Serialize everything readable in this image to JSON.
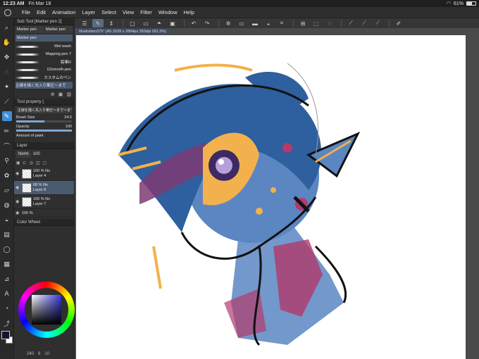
{
  "status": {
    "time": "12:23 AM",
    "date": "Fri Mar 18",
    "battery": "61%",
    "battery_level": 61
  },
  "menu": [
    "File",
    "Edit",
    "Animation",
    "Layer",
    "Select",
    "View",
    "Filter",
    "Window",
    "Help"
  ],
  "subtool": {
    "header": "Sub Tool [Marker pen 2]",
    "tabs": [
      "Marker pen",
      "Marker pen",
      "Marker pen"
    ],
    "brushes": [
      "Wet wash",
      "Mapping pen 7",
      "鉛筆R",
      "GSmooth-pen",
      "カスタムのペン",
      "主線を描く先入り筆圧〜まで"
    ]
  },
  "toolprop": {
    "header": "Tool property [",
    "banner": "主線を描く先入り筆圧〜まで〜まで",
    "brush_size_label": "Brush Size",
    "brush_size_value": "24.5",
    "brush_size_level": 0.5,
    "opacity_label": "Opacity",
    "opacity_value": "100",
    "opacity_level": 1.0,
    "amount_label": "Amount of paint"
  },
  "layer_panel": {
    "header": "Layer",
    "blend_mode": "Norm",
    "opacity": "100",
    "layers": [
      {
        "percent": "100 %",
        "mode": "No",
        "name": "Layer 4",
        "selected": false
      },
      {
        "percent": "68 %",
        "mode": "No",
        "name": "Layer 8",
        "selected": true
      },
      {
        "percent": "100 %",
        "mode": "No",
        "name": "Layer 7",
        "selected": false
      },
      {
        "percent": "100 %",
        "mode": "",
        "name": "",
        "selected": false
      }
    ]
  },
  "color_wheel": {
    "header": "Color Wheel"
  },
  "colors": {
    "main": "#151530",
    "sub": "#ffffff",
    "accent": "#3f8fd6"
  },
  "bottom": {
    "size": "240",
    "a": "8",
    "b": "10"
  },
  "document": {
    "tab": "Illustration375* (A5 2039 x 2894px 350dpi 281.5%)"
  }
}
